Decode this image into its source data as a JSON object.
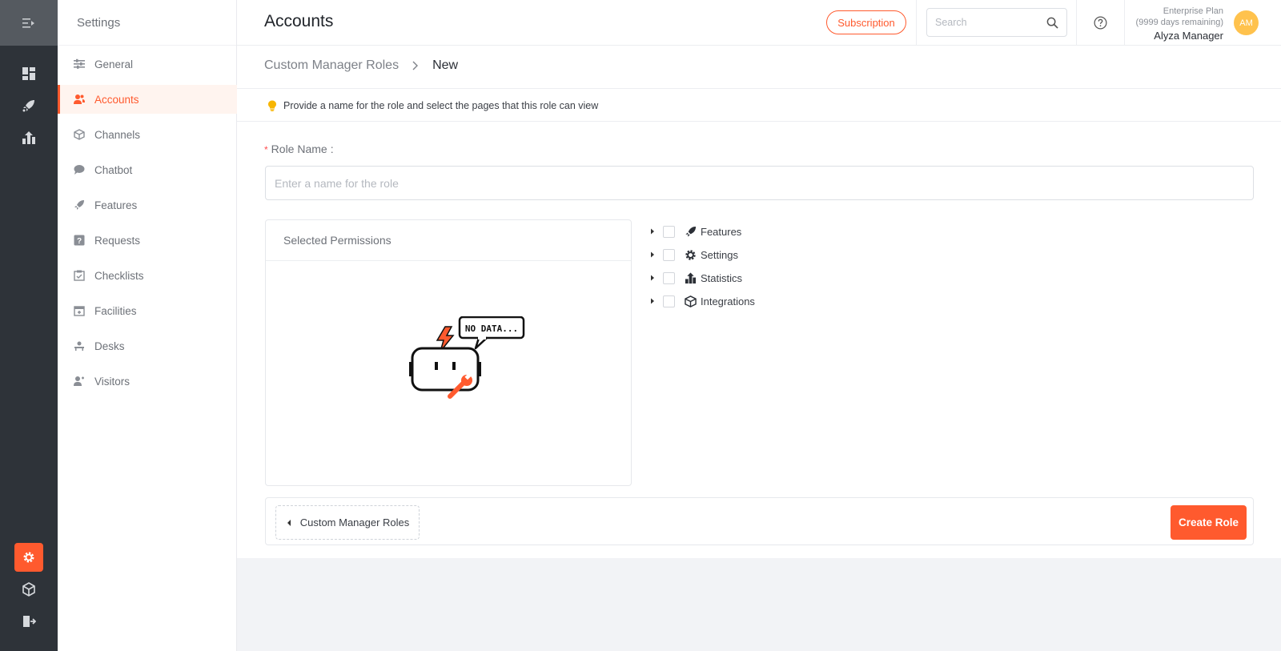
{
  "colors": {
    "accent": "#ff5a2e",
    "rail": "#2e3339",
    "avatar": "#ffc24d"
  },
  "rail": {
    "items": [
      {
        "name": "menu-toggle-icon"
      },
      {
        "name": "dashboard-icon"
      },
      {
        "name": "rocket-icon"
      },
      {
        "name": "statistics-icon"
      },
      {
        "name": "settings-gear-icon"
      },
      {
        "name": "integrations-box-icon"
      },
      {
        "name": "logout-icon"
      }
    ]
  },
  "sidebar": {
    "title": "Settings",
    "items": [
      {
        "label": "General",
        "icon": "sliders-icon"
      },
      {
        "label": "Accounts",
        "icon": "users-icon",
        "active": true
      },
      {
        "label": "Channels",
        "icon": "box-icon"
      },
      {
        "label": "Chatbot",
        "icon": "chat-bubble-icon"
      },
      {
        "label": "Features",
        "icon": "rocket-icon"
      },
      {
        "label": "Requests",
        "icon": "question-square-icon"
      },
      {
        "label": "Checklists",
        "icon": "checklist-icon"
      },
      {
        "label": "Facilities",
        "icon": "calendar-plus-icon"
      },
      {
        "label": "Desks",
        "icon": "desk-icon"
      },
      {
        "label": "Visitors",
        "icon": "visitor-icon"
      }
    ]
  },
  "header": {
    "title": "Accounts",
    "subscription_label": "Subscription",
    "search_placeholder": "Search",
    "plan_name": "Enterprise Plan",
    "plan_remaining": "(9999 days remaining)",
    "user_name": "Alyza Manager",
    "avatar_initials": "AM"
  },
  "main": {
    "breadcrumb_root": "Custom Manager Roles",
    "breadcrumb_current": "New",
    "tip": "Provide a name for the role and select the pages that this role can view",
    "role_label": "Role Name",
    "role_label_suffix": ":",
    "role_required_mark": "*",
    "role_placeholder": "Enter a name for the role",
    "selected_permissions_title": "Selected Permissions",
    "nodata_text": "NO DATA...",
    "tree": [
      {
        "label": "Features",
        "icon": "rocket-icon"
      },
      {
        "label": "Settings",
        "icon": "gear-icon"
      },
      {
        "label": "Statistics",
        "icon": "statistics-icon"
      },
      {
        "label": "Integrations",
        "icon": "box-icon"
      }
    ],
    "back_label": "Custom Manager Roles",
    "create_label": "Create Role"
  }
}
